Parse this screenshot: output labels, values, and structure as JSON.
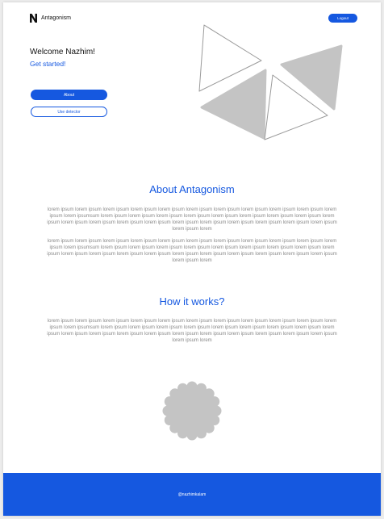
{
  "header": {
    "brand": "Antagonism",
    "logout_label": "Logout"
  },
  "hero": {
    "welcome": "Welcome Nazhim!",
    "get_started": "Get started!",
    "about_button": "About",
    "detector_button": "Use detector"
  },
  "about": {
    "title": "About Antagonism",
    "paragraph1": "lorem ipsum lorem ipsum lorem ipsum lorem ipsum lorem ipsum lorem ipsum lorem ipsum lorem ipsum lorem ipsum lorem ipsum lorem ipsum lorem ipsumsum lorem ipsum lorem ipsum lorem ipsum lorem ipsum lorem ipsum lorem ipsum lorem ipsum lorem ipsum lorem ipsum lorem ipsum lorem ipsum lorem ipsum lorem ipsum lorem ipsum lorem ipsum lorem ipsum lorem ipsum lorem ipsum lorem ipsum lorem ipsum lorem",
    "paragraph2": "lorem ipsum lorem ipsum lorem ipsum lorem ipsum lorem ipsum lorem ipsum lorem ipsum lorem ipsum lorem ipsum lorem ipsum lorem ipsum lorem ipsumsum lorem ipsum lorem ipsum lorem ipsum lorem ipsum lorem ipsum lorem ipsum lorem ipsum lorem ipsum lorem ipsum lorem ipsum lorem ipsum lorem ipsum lorem ipsum lorem ipsum lorem ipsum lorem ipsum lorem ipsum lorem ipsum lorem ipsum lorem ipsum lorem"
  },
  "how": {
    "title": "How it works?",
    "paragraph": "lorem ipsum lorem ipsum lorem ipsum lorem ipsum lorem ipsum lorem ipsum lorem ipsum lorem ipsum lorem ipsum lorem ipsum lorem ipsum lorem ipsumsum lorem ipsum lorem ipsum lorem ipsum lorem ipsum lorem ipsum lorem ipsum lorem ipsum lorem ipsum lorem ipsum lorem ipsum lorem ipsum lorem ipsum lorem ipsum lorem ipsum lorem ipsum lorem ipsum lorem ipsum lorem ipsum lorem ipsum lorem ipsum lorem"
  },
  "footer": {
    "handle": "@nazhimkalam"
  },
  "colors": {
    "accent": "#1558e0",
    "shape_gray": "#c4c4c4"
  },
  "icons": {
    "logo": "n-logo-icon",
    "hero_art": "triangles-illustration",
    "flower": "scalloped-flower-shape"
  }
}
